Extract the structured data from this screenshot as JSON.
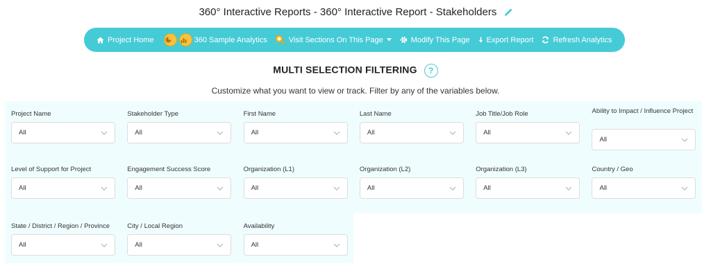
{
  "page_title": "360° Interactive Reports - 360° Interactive Report - Stakeholders",
  "navbar": {
    "project_home": "Project Home",
    "sample_analytics": "360 Sample Analytics",
    "visit_sections": "Visit Sections On This Page",
    "modify_page": "Modify This Page",
    "export_report": "Export Report",
    "refresh_analytics": "Refresh Analytics"
  },
  "section": {
    "title": "MULTI SELECTION FILTERING",
    "help": "?",
    "subtitle": "Customize what you want to view or track. Filter by any of the variables below."
  },
  "filters": [
    {
      "label": "Project Name",
      "value": "All"
    },
    {
      "label": "Stakeholder Type",
      "value": "All"
    },
    {
      "label": "First Name",
      "value": "All"
    },
    {
      "label": "Last Name",
      "value": "All"
    },
    {
      "label": "Job Title/Job Role",
      "value": "All"
    },
    {
      "label": "Ability to Impact / Influence Project",
      "value": "All"
    },
    {
      "label": "Level of Support for Project",
      "value": "All"
    },
    {
      "label": "Engagement Success Score",
      "value": "All"
    },
    {
      "label": "Organization (L1)",
      "value": "All"
    },
    {
      "label": "Organization (L2)",
      "value": "All"
    },
    {
      "label": "Organization (L3)",
      "value": "All"
    },
    {
      "label": "Country / Geo",
      "value": "All"
    },
    {
      "label": "State / District / Region / Province",
      "value": "All"
    },
    {
      "label": "City / Local Region",
      "value": "All"
    },
    {
      "label": "Availability",
      "value": "All"
    }
  ],
  "colors": {
    "accent": "#45cbd6",
    "filter_bg": "#f0fdfe",
    "coin": "#f5c242"
  }
}
